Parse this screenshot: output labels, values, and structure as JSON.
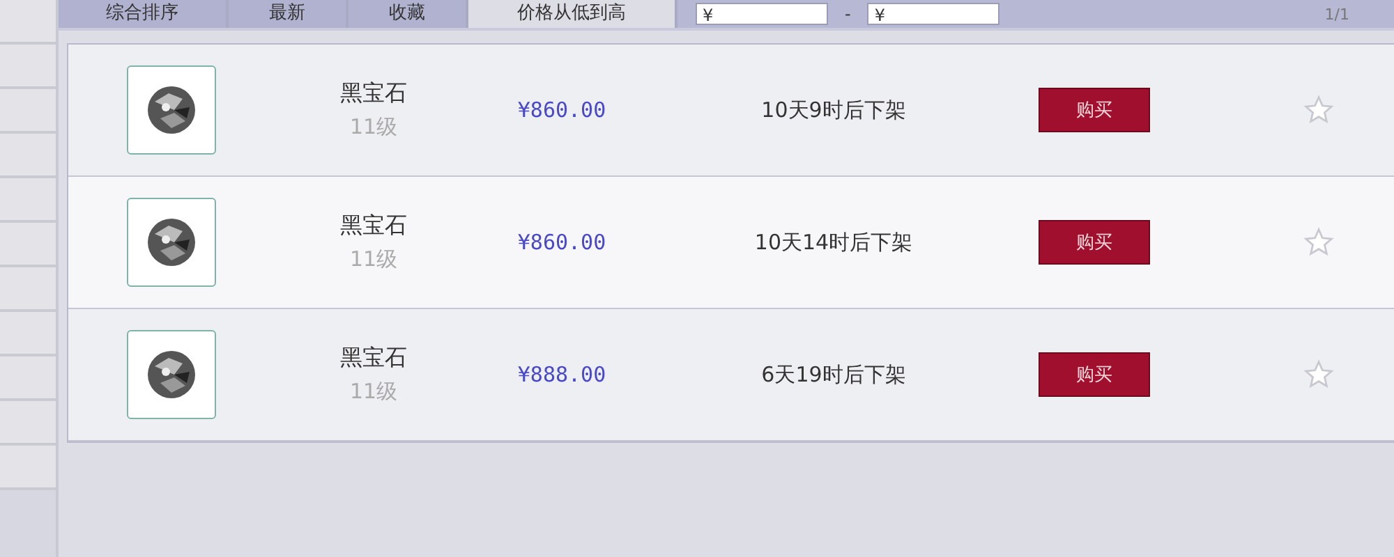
{
  "sort_tabs": [
    {
      "label": "综合排序",
      "selected": false
    },
    {
      "label": "最新",
      "selected": false
    },
    {
      "label": "收藏",
      "selected": false
    },
    {
      "label": "价格从低到高",
      "selected": true
    }
  ],
  "price_filter": {
    "min_value": "¥",
    "separator": "-",
    "max_value": "¥"
  },
  "pagination": "1/1",
  "items": [
    {
      "name": "黑宝石",
      "level": "11级",
      "price": "¥860.00",
      "time_left": "10天9时后下架",
      "buy": "购买",
      "favorited": false
    },
    {
      "name": "黑宝石",
      "level": "11级",
      "price": "¥860.00",
      "time_left": "10天14时后下架",
      "buy": "购买",
      "favorited": false
    },
    {
      "name": "黑宝石",
      "level": "11级",
      "price": "¥888.00",
      "time_left": "6天19时后下架",
      "buy": "购买",
      "favorited": false
    }
  ]
}
